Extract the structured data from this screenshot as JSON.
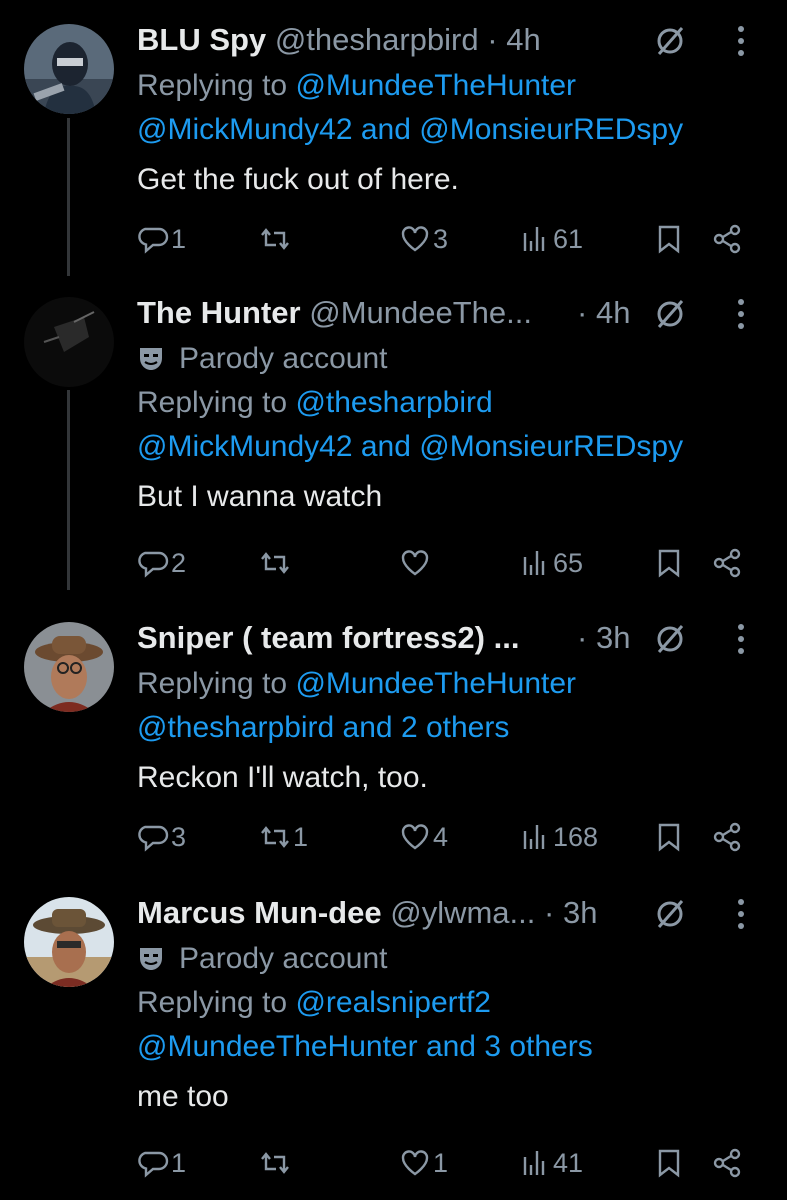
{
  "tweets": [
    {
      "name": "BLU Spy",
      "handle": "@thesharpbird",
      "dot": "·",
      "time": "4h",
      "parody": "",
      "reply_prefix": "Replying to ",
      "reply_line1": "@MundeeTheHunter",
      "reply_line2": "@MickMundy42 and @MonsieurREDspy",
      "text": "Get the fuck out of here.",
      "reply_count": "1",
      "retweet_count": "",
      "like_count": "3",
      "view_count": "61"
    },
    {
      "name": "The Hunter",
      "handle": "@MundeeThe...",
      "dot": "·",
      "time": "4h",
      "parody": "Parody account",
      "reply_prefix": "Replying to ",
      "reply_line1": "@thesharpbird",
      "reply_line2": "@MickMundy42 and @MonsieurREDspy",
      "text": "But I wanna watch",
      "reply_count": "2",
      "retweet_count": "",
      "like_count": "",
      "view_count": "65"
    },
    {
      "name": "Sniper ( team fortress2) ...",
      "handle": "",
      "dot": "·",
      "time": "3h",
      "parody": "",
      "reply_prefix": "Replying to ",
      "reply_line1": "@MundeeTheHunter",
      "reply_line2": "@thesharpbird and 2 others",
      "text": "Reckon I'll watch, too.",
      "reply_count": "3",
      "retweet_count": "1",
      "like_count": "4",
      "view_count": "168"
    },
    {
      "name": "Marcus Mun-dee",
      "handle": "@ylwma...",
      "dot": "·",
      "time": "3h",
      "parody": "Parody account",
      "reply_prefix": "Replying to ",
      "reply_line1": "@realsnipertf2",
      "reply_line2": "@MundeeTheHunter and 3 others",
      "text": "me too",
      "reply_count": "1",
      "retweet_count": "",
      "like_count": "1",
      "view_count": "41"
    }
  ],
  "icons": {
    "reply": "reply-icon",
    "retweet": "retweet-icon",
    "like": "like-icon",
    "views": "views-icon",
    "bookmark": "bookmark-icon",
    "share": "share-icon",
    "grok": "grok-icon",
    "more": "more-icon",
    "parody": "parody-mask-icon"
  },
  "colors": {
    "background": "#000000",
    "text": "#e7e9ea",
    "muted": "#8b98a5",
    "link": "#1d9bf0",
    "thread_line": "#333639"
  }
}
